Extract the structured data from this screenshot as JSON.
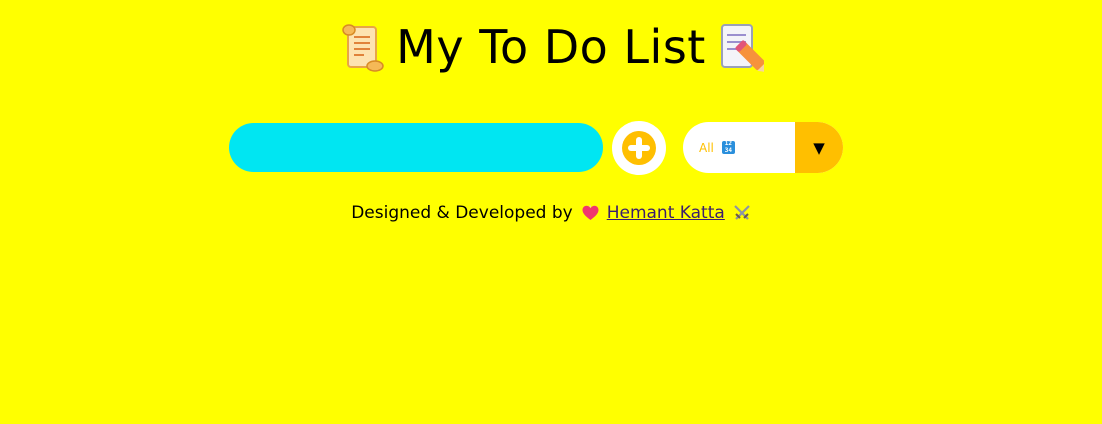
{
  "header": {
    "title": "My To Do List",
    "left_icon": "scroll-icon",
    "right_icon": "memo-icon"
  },
  "controls": {
    "input_value": "",
    "input_placeholder": "",
    "add_button_icon": "plus-circle-icon",
    "filter": {
      "selected": "All",
      "badge_icon": "input-numbers-icon",
      "dropdown_arrow": "▼"
    }
  },
  "footer": {
    "credit_text": "Designed & Developed by",
    "author_link": "Hemant Katta",
    "heart_icon": "heart-icon",
    "swords_icon": "crossed-swords-icon"
  },
  "colors": {
    "background": "#ffff00",
    "input": "#00e6f2",
    "accent": "#ffbf00",
    "link": "#3a1d6e"
  }
}
